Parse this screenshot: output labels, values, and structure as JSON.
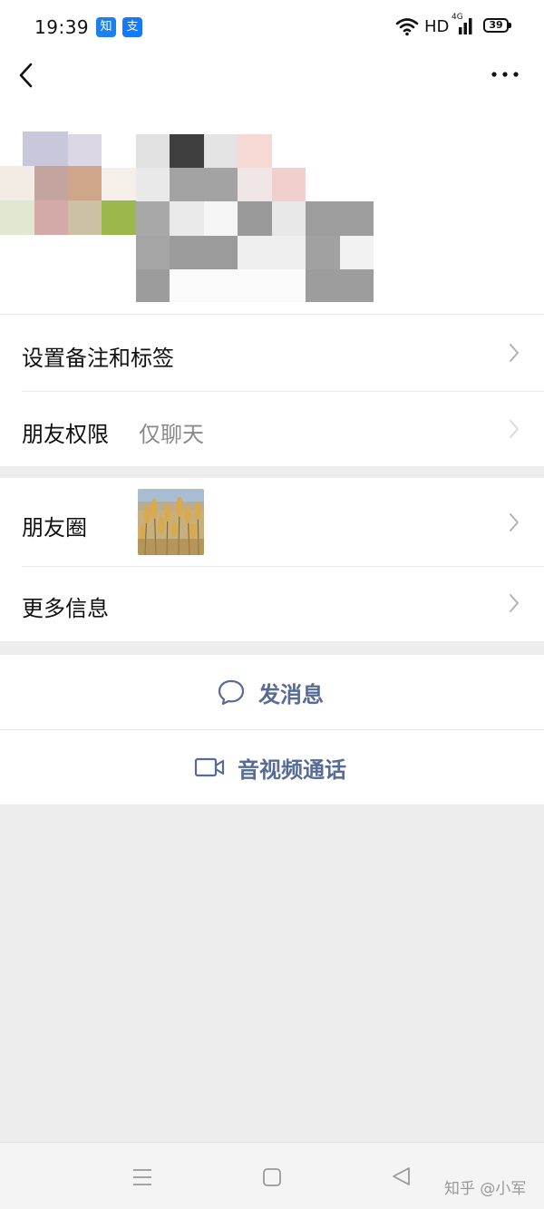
{
  "status_bar": {
    "time": "19:39",
    "app_badges": [
      "知",
      "支"
    ],
    "network": "HD",
    "network_gen": "4G",
    "battery": "39"
  },
  "nav": {
    "back_icon": "chevron-left-icon",
    "more_icon": "more-dots-icon"
  },
  "section1": {
    "rows": [
      {
        "label": "设置备注和标签",
        "value": ""
      },
      {
        "label": "朋友权限",
        "value": "仅聊天"
      }
    ]
  },
  "section2": {
    "rows": [
      {
        "label": "朋友圈"
      },
      {
        "label": "更多信息"
      }
    ]
  },
  "actions": {
    "send_message": "发消息",
    "video_call": "音视频通话"
  },
  "colors": {
    "accent": "#576b95",
    "background": "#ededed"
  },
  "bottom_nav": {
    "watermark": "知乎 @小军"
  }
}
